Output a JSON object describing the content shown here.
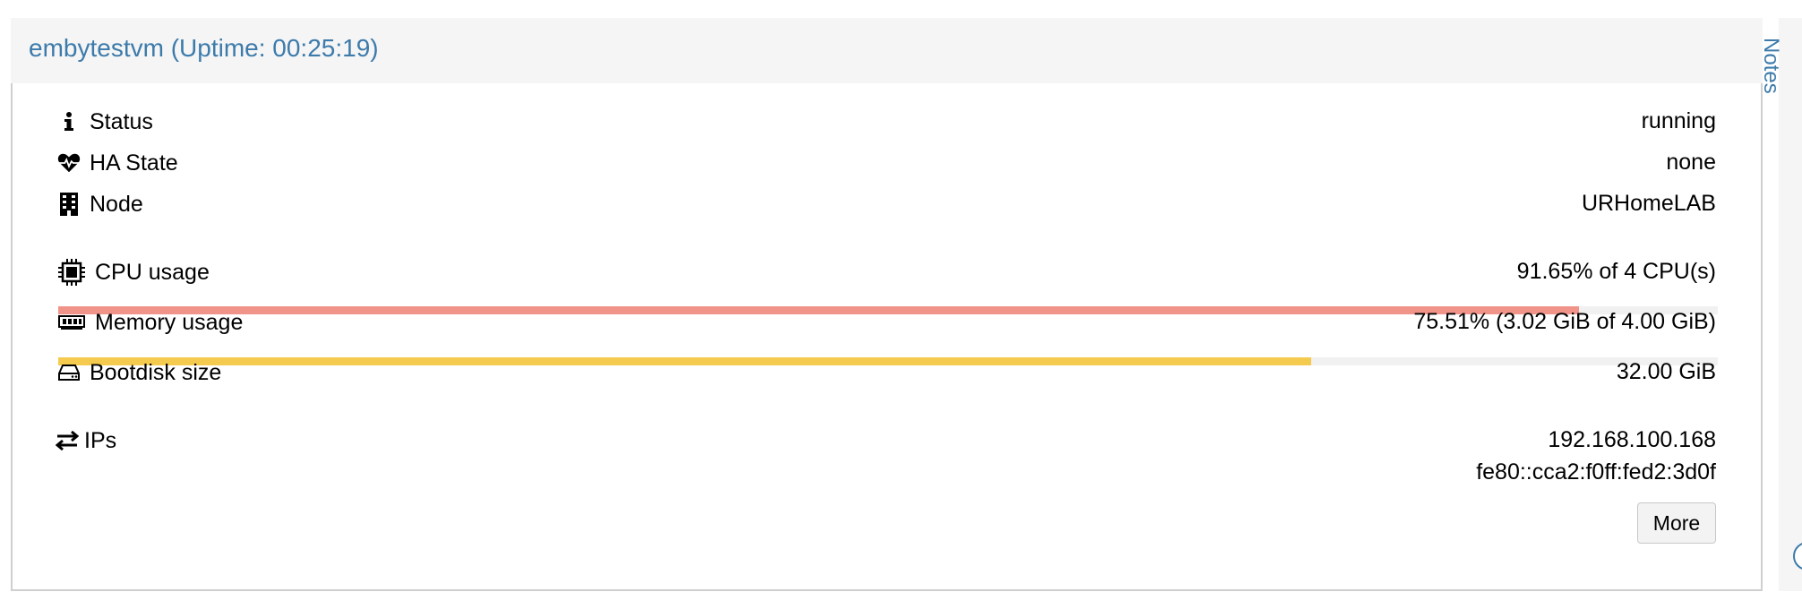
{
  "panel": {
    "title": "embytestvm (Uptime: 00:25:19)"
  },
  "rows": {
    "status": {
      "label": "Status",
      "value": "running",
      "icon": "info-icon"
    },
    "ha_state": {
      "label": "HA State",
      "value": "none",
      "icon": "heartbeat-icon"
    },
    "node": {
      "label": "Node",
      "value": "URHomeLAB",
      "icon": "building-icon"
    },
    "cpu": {
      "label": "CPU usage",
      "value": "91.65% of 4 CPU(s)",
      "icon": "cpu-chip-icon",
      "percent": 91.65,
      "bar_color": "#f0948a"
    },
    "memory": {
      "label": "Memory usage",
      "value": "75.51% (3.02 GiB of 4.00 GiB)",
      "icon": "memory-icon",
      "percent": 75.51,
      "bar_color": "#f4cb4e"
    },
    "bootdisk": {
      "label": "Bootdisk size",
      "value": "32.00 GiB",
      "icon": "hard-drive-icon"
    },
    "ips": {
      "label": "IPs",
      "values": [
        "192.168.100.168",
        "fe80::cca2:f0ff:fed2:3d0f"
      ],
      "icon": "exchange-icon"
    }
  },
  "buttons": {
    "more_label": "More"
  },
  "side_panel": {
    "label": "Notes"
  },
  "colors": {
    "accent": "#3d7bab",
    "cpu_bar": "#f0948a",
    "memory_bar": "#f4cb4e"
  }
}
